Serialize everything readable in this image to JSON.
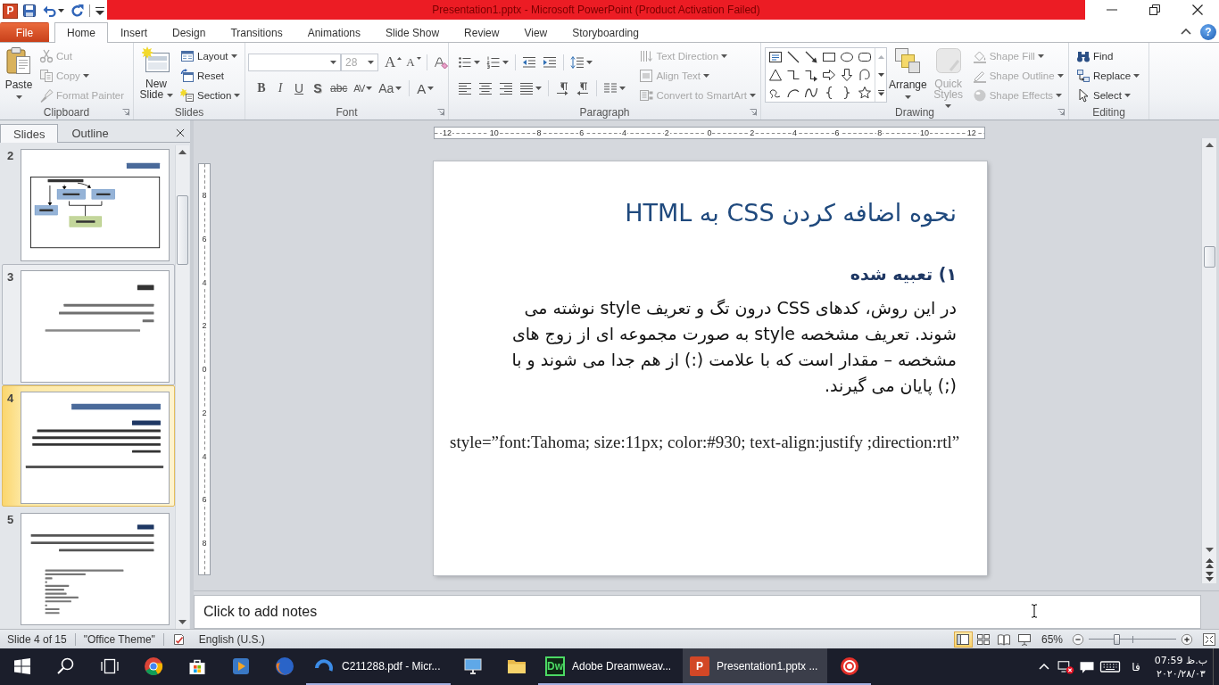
{
  "window": {
    "title": "Presentation1.pptx - Microsoft PowerPoint (Product Activation Failed)",
    "app_letter": "P"
  },
  "ribbon_tabs": [
    {
      "label": "File",
      "kind": "file",
      "selected": false
    },
    {
      "label": "Home",
      "kind": "tab",
      "selected": true
    },
    {
      "label": "Insert",
      "kind": "tab",
      "selected": false
    },
    {
      "label": "Design",
      "kind": "tab",
      "selected": false
    },
    {
      "label": "Transitions",
      "kind": "tab",
      "selected": false
    },
    {
      "label": "Animations",
      "kind": "tab",
      "selected": false
    },
    {
      "label": "Slide Show",
      "kind": "tab",
      "selected": false
    },
    {
      "label": "Review",
      "kind": "tab",
      "selected": false
    },
    {
      "label": "View",
      "kind": "tab",
      "selected": false
    },
    {
      "label": "Storyboarding",
      "kind": "tab",
      "selected": false
    }
  ],
  "help": {
    "glyph": "?"
  },
  "clipboard": {
    "label": "Clipboard",
    "paste": {
      "label": "Paste",
      "dropdown": true
    },
    "commands": [
      {
        "kind": "cut",
        "label": "Cut",
        "dropdown": false,
        "disabled": true
      },
      {
        "kind": "copy",
        "label": "Copy",
        "dropdown": true,
        "disabled": true
      },
      {
        "kind": "format_painter",
        "label": "Format Painter",
        "dropdown": false,
        "disabled": true
      }
    ]
  },
  "slides_group": {
    "label": "Slides",
    "new_slide": {
      "label": "New Slide",
      "dropdown": true
    },
    "commands": [
      {
        "kind": "layout",
        "label": "Layout",
        "dropdown": true,
        "disabled": false
      },
      {
        "kind": "reset",
        "label": "Reset",
        "dropdown": false,
        "disabled": false
      },
      {
        "kind": "section",
        "label": "Section",
        "dropdown": true,
        "disabled": false
      }
    ]
  },
  "font": {
    "label": "Font",
    "size": {
      "value": "28",
      "disabled": true
    },
    "size_buttons": [
      {
        "kind": "grow",
        "glyph": "A"
      },
      {
        "kind": "shrink",
        "glyph": "A"
      }
    ],
    "format_buttons": [
      {
        "kind": "bold",
        "glyph": "B",
        "dropdown": false
      },
      {
        "kind": "italic",
        "glyph": "I",
        "dropdown": false
      },
      {
        "kind": "underline",
        "glyph": "U",
        "dropdown": false
      },
      {
        "kind": "shadow",
        "glyph": "S",
        "dropdown": false
      },
      {
        "kind": "strikethrough",
        "glyph": "abc",
        "dropdown": false
      },
      {
        "kind": "spacing",
        "glyph": "AV",
        "dropdown": true
      },
      {
        "kind": "case",
        "glyph": "Aa",
        "dropdown": true
      },
      {
        "kind": "color",
        "glyph": "A",
        "dropdown": true
      }
    ]
  },
  "paragraph": {
    "label": "Paragraph",
    "commands": [
      {
        "kind": "text_direction",
        "label": "Text Direction",
        "dropdown": true,
        "disabled": true
      },
      {
        "kind": "align_text",
        "label": "Align Text",
        "dropdown": true,
        "disabled": true
      },
      {
        "kind": "smartart",
        "label": "Convert to SmartArt",
        "dropdown": true,
        "disabled": true
      }
    ]
  },
  "drawing": {
    "label": "Drawing",
    "arrange": {
      "label": "Arrange",
      "dropdown": true,
      "disabled": false
    },
    "quick_styles": {
      "label": "Quick Styles",
      "dropdown": true,
      "disabled": true
    },
    "commands": [
      {
        "kind": "shape_fill",
        "label": "Shape Fill",
        "dropdown": true,
        "disabled": true
      },
      {
        "kind": "shape_outline",
        "label": "Shape Outline",
        "dropdown": true,
        "disabled": true
      },
      {
        "kind": "shape_effects",
        "label": "Shape Effects",
        "dropdown": true,
        "disabled": true
      }
    ]
  },
  "editing": {
    "label": "Editing",
    "commands": [
      {
        "kind": "find",
        "label": "Find",
        "dropdown": false,
        "disabled": false
      },
      {
        "kind": "replace",
        "label": "Replace",
        "dropdown": true,
        "disabled": false
      },
      {
        "kind": "select",
        "label": "Select",
        "dropdown": true,
        "disabled": false
      }
    ]
  },
  "slides_panel": {
    "tabs": [
      {
        "label": "Slides",
        "selected": true
      },
      {
        "label": "Outline",
        "selected": false
      }
    ],
    "thumbnails": [
      {
        "number": "2",
        "kind": "diagram",
        "selected": false,
        "hovered": false
      },
      {
        "number": "3",
        "kind": "note",
        "selected": false,
        "hovered": true
      },
      {
        "number": "4",
        "kind": "text",
        "selected": true,
        "hovered": false
      },
      {
        "number": "5",
        "kind": "code",
        "selected": false,
        "hovered": false
      }
    ]
  },
  "ruler": {
    "horizontal": [
      "12",
      "10",
      "8",
      "6",
      "4",
      "2",
      "0",
      "2",
      "4",
      "6",
      "8",
      "10",
      "12"
    ],
    "vertical": [
      "8",
      "6",
      "4",
      "2",
      "0",
      "2",
      "4",
      "6",
      "8"
    ]
  },
  "slide": {
    "title": "نحوه اضافه کردن CSS به HTML",
    "heading": "۱) تعبیه شده",
    "body": "در این روش، کدهای CSS درون تگ و تعریف style نوشته می شوند. تعریف مشخصه style به صورت مجموعه ای از زوج های مشخصه – مقدار است که با علامت (:) از هم جدا می شوند و با (;) پایان می گیرند.",
    "code": "style=”font:Tahoma; size:11px; color:#930; text-align:justify ;direction:rtl”"
  },
  "notes": {
    "placeholder": "Click to add notes"
  },
  "status_bar": {
    "slide_info": "Slide 4 of 15",
    "theme": "\"Office Theme\"",
    "language": "English (U.S.)",
    "views": [
      {
        "kind": "normal",
        "selected": true
      },
      {
        "kind": "sorter",
        "selected": false
      },
      {
        "kind": "reading",
        "selected": false
      },
      {
        "kind": "slideshow",
        "selected": false
      }
    ],
    "zoom": {
      "reading": "65%",
      "level": 0.32
    }
  },
  "taskbar": {
    "apps": [
      {
        "kind": "circle_app",
        "selected": false,
        "running": false
      },
      {
        "kind": "store",
        "selected": false,
        "running": false
      },
      {
        "kind": "player",
        "selected": false,
        "running": false
      },
      {
        "kind": "globe",
        "selected": false,
        "running": false
      },
      {
        "kind": "swirl",
        "label": "C211288.pdf - Micr...",
        "selected": false,
        "running": true
      },
      {
        "kind": "monitor",
        "selected": false,
        "running": false
      },
      {
        "kind": "folder",
        "selected": false,
        "running": false
      },
      {
        "kind": "logo_green",
        "icon_text": "Dw",
        "label": "Adobe Dreamweav...",
        "selected": false,
        "running": true
      },
      {
        "kind": "logo_orange",
        "icon_text": "P",
        "label": "Presentation1.pptx ...",
        "selected": true,
        "running": true
      },
      {
        "kind": "record",
        "selected": false,
        "running": true
      }
    ],
    "tray": {
      "language": "فا",
      "time": "07:59 ب.ظ",
      "date": "۲۰۲۰/۲۸/۰۳"
    }
  }
}
